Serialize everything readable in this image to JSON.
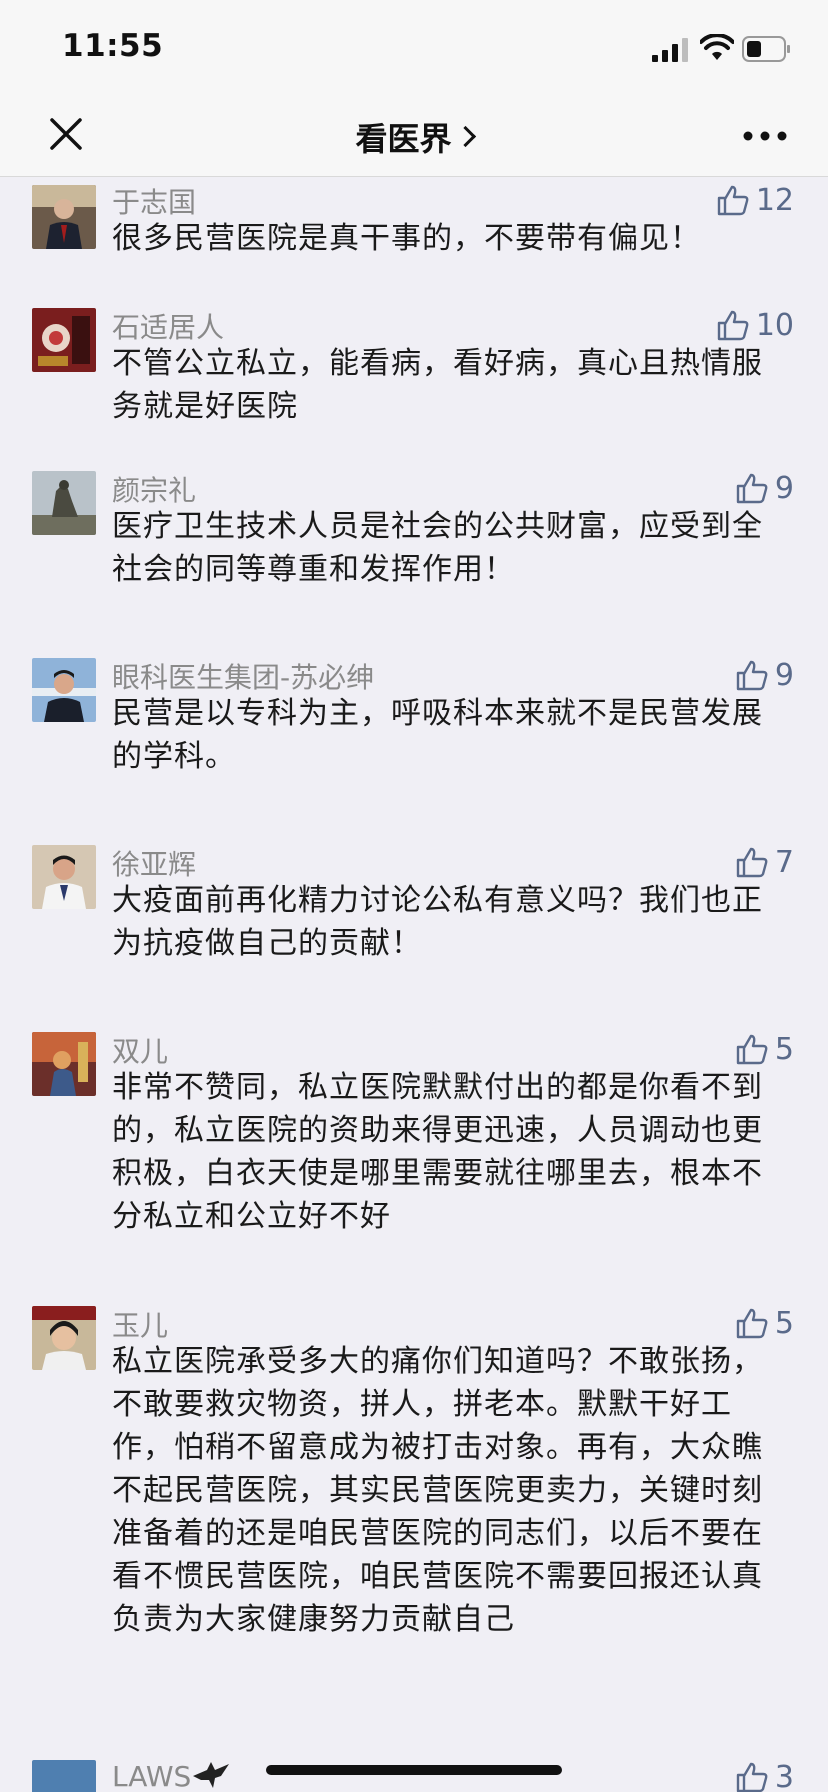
{
  "status_bar": {
    "time": "11:55"
  },
  "nav": {
    "title": "看医界"
  },
  "comments": [
    {
      "author": "于志国",
      "likes": "12",
      "text": "很多民营医院是真干事的，不要带有偏见！"
    },
    {
      "author": "石适居人",
      "likes": "10",
      "text": "不管公立私立，能看病，看好病，真心且热情服务就是好医院"
    },
    {
      "author": "颜宗礼",
      "likes": "9",
      "text": "医疗卫生技术人员是社会的公共财富，应受到全社会的同等尊重和发挥作用！"
    },
    {
      "author": "眼科医生集团-苏必绅",
      "likes": "9",
      "text": "民营是以专科为主，呼吸科本来就不是民营发展的学科。"
    },
    {
      "author": "徐亚辉",
      "likes": "7",
      "text": "大疫面前再化精力讨论公私有意义吗？我们也正为抗疫做自己的贡献！"
    },
    {
      "author": "双儿",
      "likes": "5",
      "text": "非常不赞同，私立医院默默付出的都是你看不到的，私立医院的资助来得更迅速，人员调动也更积极，白衣天使是哪里需要就往哪里去，根本不分私立和公立好不好"
    },
    {
      "author": "玉儿",
      "likes": "5",
      "text": "私立医院承受多大的痛你们知道吗？不敢张扬，不敢要救灾物资，拼人，拼老本。默默干好工作，怕稍不留意成为被打击对象。再有，大众瞧不起民营医院，其实民营医院更卖力，关键时刻准备着的还是咱民营医院的同志们，以后不要在看不惯民营医院，咱民营医院不需要回报还认真负责为大家健康努力贡献自己"
    },
    {
      "author": "LAWS",
      "likes": "3",
      "text": ""
    }
  ]
}
